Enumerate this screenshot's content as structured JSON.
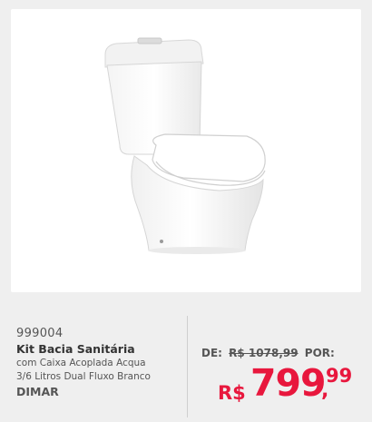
{
  "product": {
    "sku": "999004",
    "title": "Kit Bacia Sanitária",
    "desc_line1": "com Caixa Acoplada Acqua",
    "desc_line2": "3/6 Litros Dual Fluxo Branco",
    "brand": "DIMAR",
    "image_icon": "toilet-product-image"
  },
  "price": {
    "from_label": "DE:",
    "old_price": "R$ 1078,99",
    "por_label": "POR:",
    "currency": "R$",
    "integer": "799",
    "comma": ",",
    "cents": "99",
    "accent_color": "#e8173d"
  }
}
